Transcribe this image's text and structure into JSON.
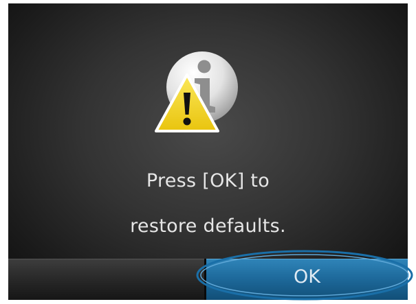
{
  "dialog": {
    "message_line_1": "Press [OK] to",
    "message_line_2": "restore defaults.",
    "icons": [
      "info-icon",
      "warning-icon"
    ]
  },
  "softkeys": {
    "left_label": "",
    "ok_label": "OK"
  },
  "colors": {
    "screen_background": "#2e2e2e",
    "text": "#e6e6e6",
    "ok_button": "#1e6a9c",
    "highlight_ring": "#1a6fa8",
    "warning_yellow": "#f2d21c"
  }
}
